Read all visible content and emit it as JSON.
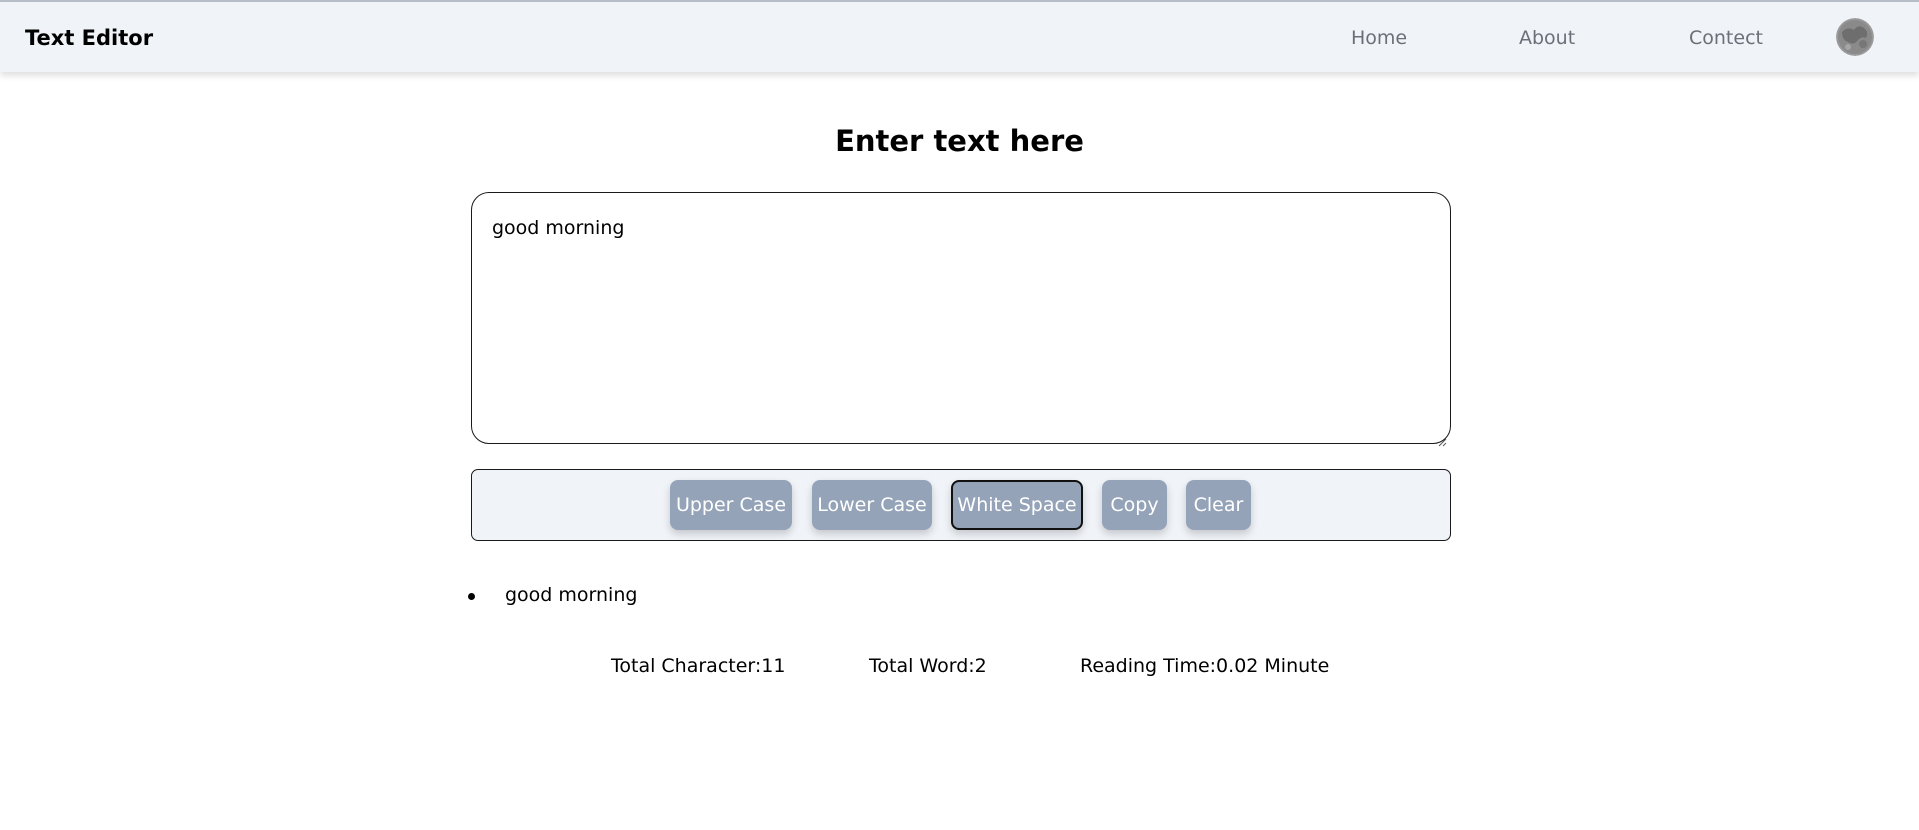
{
  "navbar": {
    "brand": "Text Editor",
    "links": [
      {
        "label": "Home"
      },
      {
        "label": "About"
      },
      {
        "label": "Contect"
      }
    ],
    "avatar_icon": "moon-avatar-icon"
  },
  "main": {
    "heading": "Enter text here",
    "textarea_value": "good morning",
    "buttons": {
      "upper_case": "Upper Case",
      "lower_case": "Lower Case",
      "white_space": "White Space",
      "copy": "Copy",
      "clear": "Clear"
    },
    "preview_items": [
      "good morning"
    ],
    "stats": {
      "total_character": "Total Character:11",
      "total_word": "Total Word:2",
      "reading_time": "Reading Time:0.02 Minute"
    }
  },
  "colors": {
    "navbar_bg": "#f0f3f8",
    "button_bg": "#94a3b8",
    "nav_link": "#6b7078"
  }
}
